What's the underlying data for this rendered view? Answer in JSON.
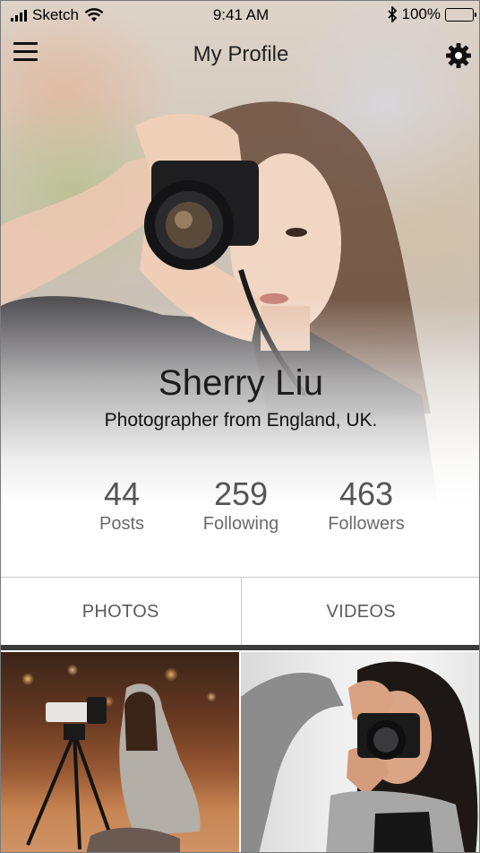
{
  "status_bar": {
    "carrier": "Sketch",
    "time": "9:41 AM",
    "battery": "100%"
  },
  "nav": {
    "title": "My Profile",
    "menu_icon": "hamburger-menu-icon",
    "settings_icon": "gear-icon"
  },
  "profile": {
    "name": "Sherry Liu",
    "bio": "Photographer from England, UK."
  },
  "stats": [
    {
      "value": "44",
      "label": "Posts"
    },
    {
      "value": "259",
      "label": "Following"
    },
    {
      "value": "463",
      "label": "Followers"
    }
  ],
  "tabs": [
    {
      "label": "PHOTOS"
    },
    {
      "label": "VIDEOS"
    }
  ],
  "colors": {
    "divider": "#c9c9c9",
    "tab_underline": "#3b3b3b",
    "stat_text": "#555555"
  }
}
